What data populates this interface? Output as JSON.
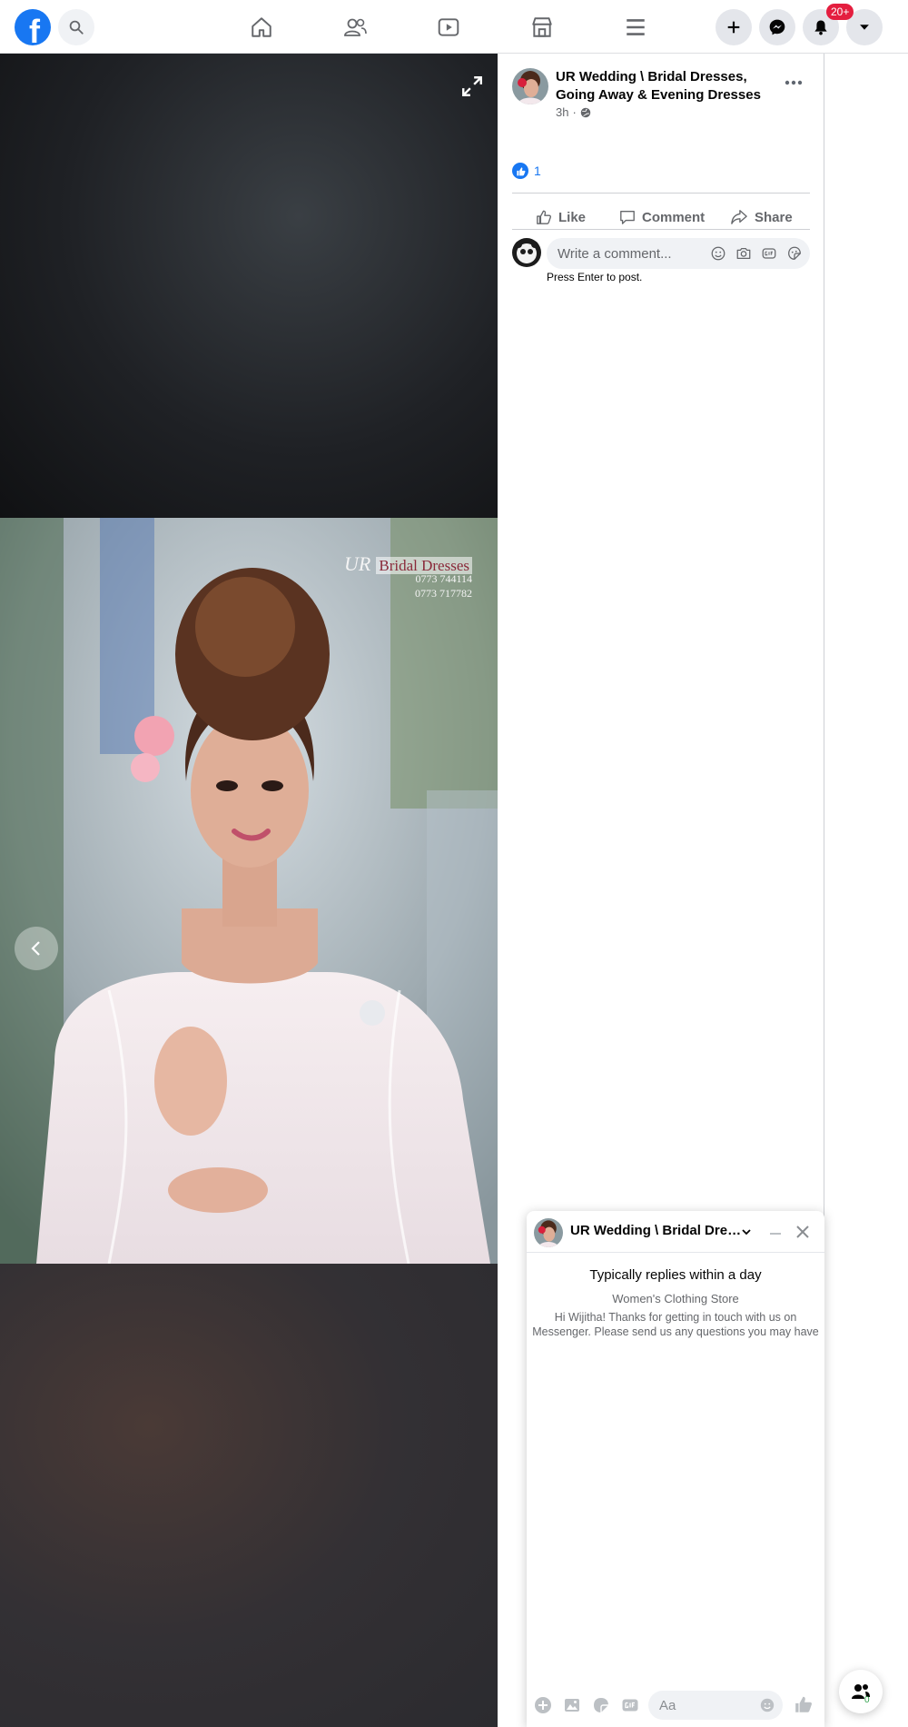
{
  "topbar": {
    "logo_letter": "f",
    "notification_badge": "20+",
    "brand_color": "#1877f2"
  },
  "photo": {
    "watermark_brand": "UR",
    "watermark_title": "Bridal Dresses",
    "watermark_phone1": "0773 744114",
    "watermark_phone2": "0773 717782"
  },
  "post": {
    "page_name": "UR Wedding \\ Bridal Dresses, Going Away & Evening Dresses",
    "time": "3h",
    "reaction_count": "1",
    "like_label": "Like",
    "comment_label": "Comment",
    "share_label": "Share",
    "comment_placeholder": "Write a comment...",
    "press_enter_hint": "Press Enter to post."
  },
  "chat": {
    "title": "UR Wedding \\ Bridal Dres…",
    "reply_time": "Typically replies within a day",
    "category": "Women's Clothing Store",
    "message_line1": "Hi Wijitha! Thanks for getting in touch with us on",
    "message_line2": "Messenger. Please send us any questions you may have",
    "input_placeholder": "Aa",
    "accent_color": "#1877f2"
  },
  "contacts_badge": "0"
}
